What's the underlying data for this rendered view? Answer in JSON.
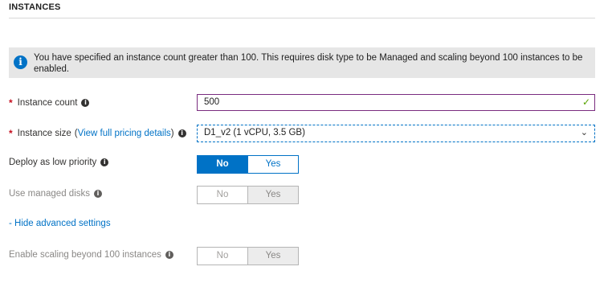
{
  "section": {
    "title": "INSTANCES"
  },
  "info_banner": {
    "text": "You have specified an instance count greater than 100. This requires disk type to be Managed and scaling beyond 100 instances to be enabled."
  },
  "fields": {
    "instance_count": {
      "required": "*",
      "label": "Instance count",
      "value": "500"
    },
    "instance_size": {
      "required": "*",
      "label": "Instance size",
      "link_open": "(",
      "link_text": "View full pricing details",
      "link_close": ")",
      "value": "D1_v2 (1 vCPU, 3.5 GB)"
    },
    "low_priority": {
      "label": "Deploy as low priority",
      "option_no": "No",
      "option_yes": "Yes",
      "selected": "No"
    },
    "managed_disks": {
      "label": "Use managed disks",
      "option_no": "No",
      "option_yes": "Yes",
      "disabled": true
    },
    "advanced_link": "- Hide advanced settings",
    "scaling_beyond": {
      "label": "Enable scaling beyond 100 instances",
      "option_no": "No",
      "option_yes": "Yes",
      "disabled": true
    }
  },
  "colors": {
    "accent": "#0072c6",
    "required": "#c50f1f",
    "valid": "#57a300",
    "input_border": "#7a2c7f",
    "banner_bg": "#e6e6e6"
  },
  "icons": {
    "info": "info-icon",
    "help": "help-icon",
    "valid": "checkmark-icon",
    "dropdown": "chevron-down-icon"
  }
}
